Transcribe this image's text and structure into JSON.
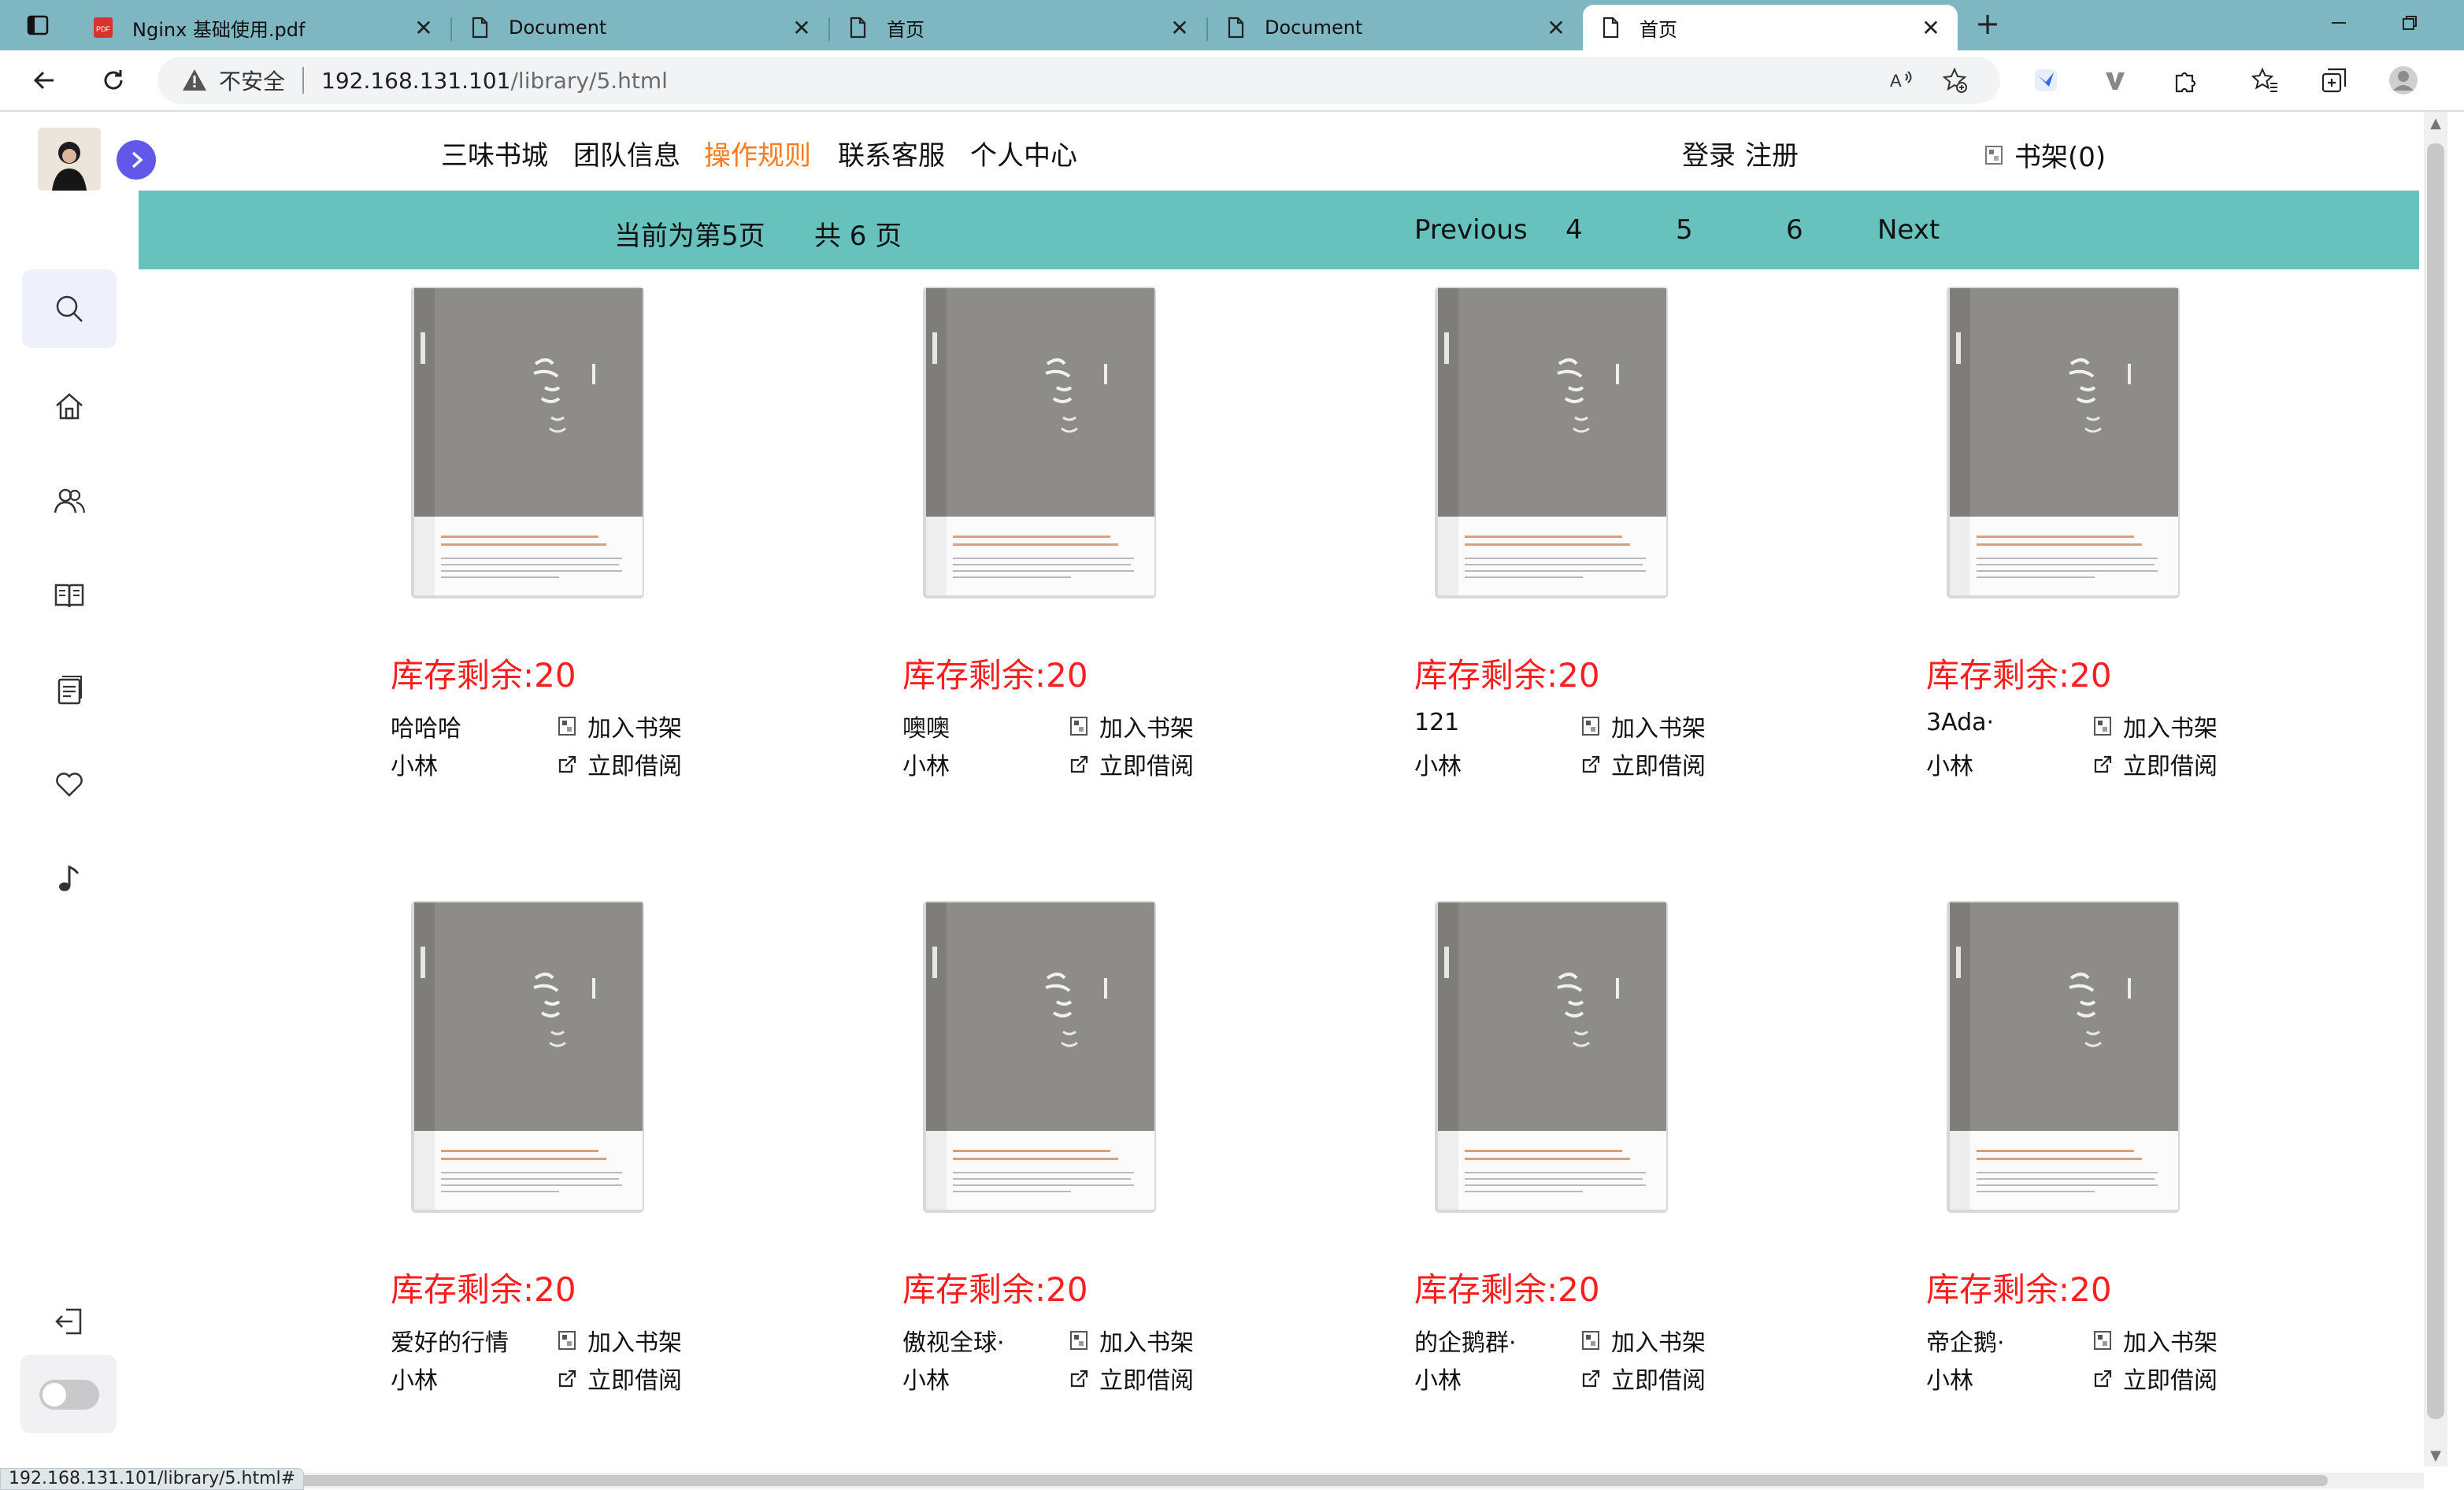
{
  "browser": {
    "tabs": [
      {
        "title": "Nginx 基础使用.pdf",
        "icon": "pdf-icon",
        "active": false
      },
      {
        "title": "Document",
        "icon": "document-icon",
        "active": false
      },
      {
        "title": "首页",
        "icon": "document-icon",
        "active": false
      },
      {
        "title": "Document",
        "icon": "document-icon",
        "active": false
      },
      {
        "title": "首页",
        "icon": "document-icon",
        "active": true
      }
    ],
    "close_glyph": "✕",
    "new_tab_glyph": "+",
    "security_label": "不安全",
    "url_host": "192.168.131.101",
    "url_path": "/library/5.html",
    "status_url": "192.168.131.101/library/5.html#"
  },
  "nav": {
    "items": [
      "三味书城",
      "团队信息",
      "操作规则",
      "联系客服",
      "个人中心"
    ],
    "active_index": 2,
    "login": "登录",
    "register": "注册",
    "shelf": "书架(0)"
  },
  "pagination": {
    "current": "当前为第5页",
    "total": "共 6 页",
    "previous": "Previous",
    "pages": [
      "4",
      "5",
      "6"
    ],
    "next": "Next"
  },
  "books": [
    {
      "stock": "库存剩余:20",
      "name": "哈哈哈",
      "author": "小林",
      "add_shelf": "加入书架",
      "borrow": "立即借阅"
    },
    {
      "stock": "库存剩余:20",
      "name": "噢噢",
      "author": "小林",
      "add_shelf": "加入书架",
      "borrow": "立即借阅"
    },
    {
      "stock": "库存剩余:20",
      "name": "121",
      "author": "小林",
      "add_shelf": "加入书架",
      "borrow": "立即借阅"
    },
    {
      "stock": "库存剩余:20",
      "name": "3Ada·",
      "author": "小林",
      "add_shelf": "加入书架",
      "borrow": "立即借阅"
    },
    {
      "stock": "库存剩余:20",
      "name": "爱好的行情",
      "author": "小林",
      "add_shelf": "加入书架",
      "borrow": "立即借阅"
    },
    {
      "stock": "库存剩余:20",
      "name": "傲视全球·",
      "author": "小林",
      "add_shelf": "加入书架",
      "borrow": "立即借阅"
    },
    {
      "stock": "库存剩余:20",
      "name": "的企鹅群·",
      "author": "小林",
      "add_shelf": "加入书架",
      "borrow": "立即借阅"
    },
    {
      "stock": "库存剩余:20",
      "name": "帝企鹅·",
      "author": "小林",
      "add_shelf": "加入书架",
      "borrow": "立即借阅"
    }
  ],
  "colors": {
    "tab_strip": "#7eb7c2",
    "pagination_bar": "#67c1bd",
    "active_nav": "#ff7a1a",
    "stock_text": "#ff1e1e",
    "sidebar_accent": "#6157e8"
  }
}
